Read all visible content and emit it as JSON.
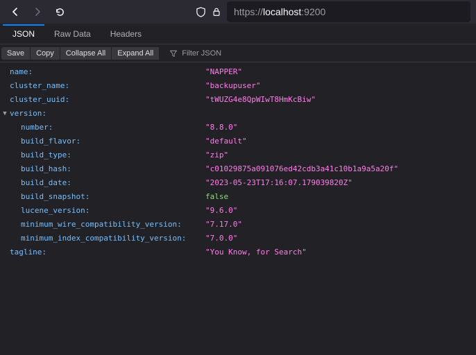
{
  "url": {
    "scheme": "https://",
    "host": "localhost",
    "port": ":9200"
  },
  "tabs": {
    "json": "JSON",
    "raw": "Raw Data",
    "headers": "Headers"
  },
  "actions": {
    "save": "Save",
    "copy": "Copy",
    "collapse": "Collapse All",
    "expand": "Expand All"
  },
  "filter": {
    "placeholder": "Filter JSON"
  },
  "json": {
    "name": {
      "k": "name",
      "v": "\"NAPPER\""
    },
    "cluster_name": {
      "k": "cluster_name",
      "v": "\"backupuser\""
    },
    "cluster_uuid": {
      "k": "cluster_uuid",
      "v": "\"tWUZG4e8QpWIwT8HmKcBiw\""
    },
    "version": {
      "k": "version"
    },
    "number": {
      "k": "number",
      "v": "\"8.8.0\""
    },
    "build_flavor": {
      "k": "build_flavor",
      "v": "\"default\""
    },
    "build_type": {
      "k": "build_type",
      "v": "\"zip\""
    },
    "build_hash": {
      "k": "build_hash",
      "v": "\"c01029875a091076ed42cdb3a41c10b1a9a5a20f\""
    },
    "build_date": {
      "k": "build_date",
      "v": "\"2023-05-23T17:16:07.179039820Z\""
    },
    "build_snapshot": {
      "k": "build_snapshot",
      "v": "false"
    },
    "lucene_version": {
      "k": "lucene_version",
      "v": "\"9.6.0\""
    },
    "min_wire": {
      "k": "minimum_wire_compatibility_version",
      "v": "\"7.17.0\""
    },
    "min_index": {
      "k": "minimum_index_compatibility_version",
      "v": "\"7.0.0\""
    },
    "tagline": {
      "k": "tagline",
      "v": "\"You Know, for Search\""
    }
  }
}
